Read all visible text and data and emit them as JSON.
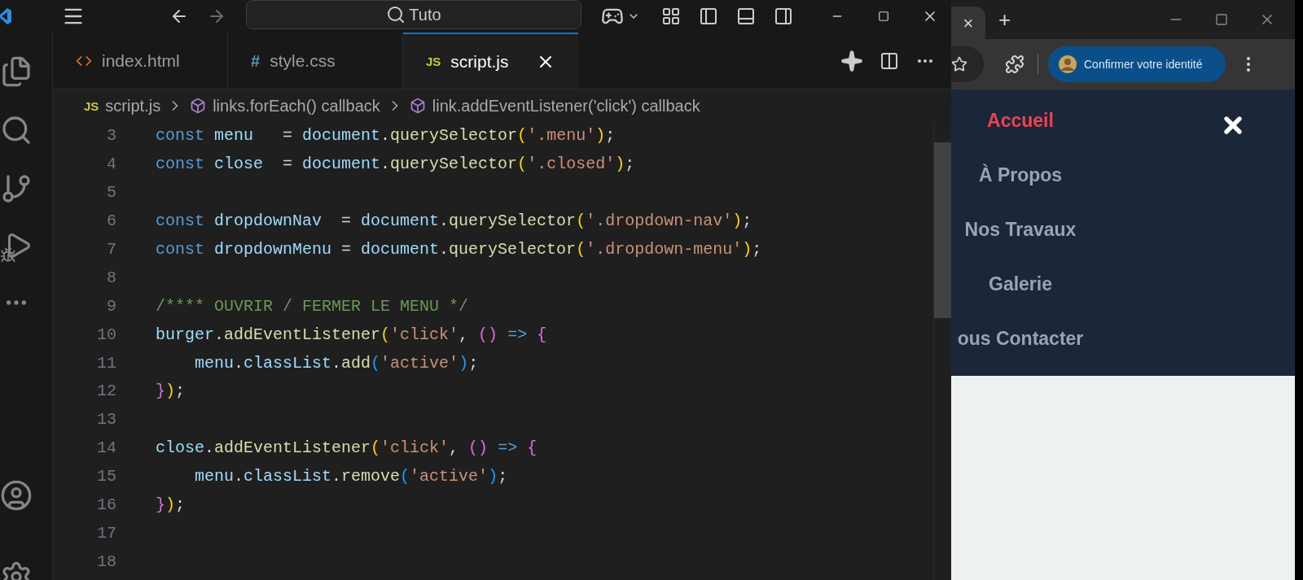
{
  "search": {
    "value": "Tuto"
  },
  "tabs": [
    {
      "label": "index.html",
      "kind": "html",
      "selected": false
    },
    {
      "label": "style.css",
      "kind": "css",
      "badge": "#",
      "selected": false
    },
    {
      "label": "script.js",
      "kind": "js",
      "badge": "JS",
      "selected": true
    }
  ],
  "breadcrumb": [
    {
      "label": "script.js",
      "kind": "js",
      "badge": "JS"
    },
    {
      "label": "links.forEach() callback",
      "kind": "symbol"
    },
    {
      "label": "link.addEventListener('click') callback",
      "kind": "symbol"
    }
  ],
  "code_lines": [
    {
      "number": "3",
      "tokens": [
        {
          "text": "const",
          "kind": "keyword"
        },
        {
          "text": " menu",
          "kind": "variable"
        },
        {
          "text": "   = ",
          "kind": "plain"
        },
        {
          "text": "document",
          "kind": "variable"
        },
        {
          "text": ".",
          "kind": "plain"
        },
        {
          "text": "querySelector",
          "kind": "function"
        },
        {
          "text": "(",
          "kind": "bracket1"
        },
        {
          "text": "'.menu'",
          "kind": "string"
        },
        {
          "text": ")",
          "kind": "bracket1"
        },
        {
          "text": ";",
          "kind": "plain"
        }
      ]
    },
    {
      "number": "4",
      "tokens": [
        {
          "text": "const",
          "kind": "keyword"
        },
        {
          "text": " close",
          "kind": "variable"
        },
        {
          "text": "  = ",
          "kind": "plain"
        },
        {
          "text": "document",
          "kind": "variable"
        },
        {
          "text": ".",
          "kind": "plain"
        },
        {
          "text": "querySelector",
          "kind": "function"
        },
        {
          "text": "(",
          "kind": "bracket1"
        },
        {
          "text": "'.closed'",
          "kind": "string"
        },
        {
          "text": ")",
          "kind": "bracket1"
        },
        {
          "text": ";",
          "kind": "plain"
        }
      ]
    },
    {
      "number": "5"
    },
    {
      "number": "6",
      "tokens": [
        {
          "text": "const",
          "kind": "keyword"
        },
        {
          "text": " dropdownNav",
          "kind": "variable"
        },
        {
          "text": "  = ",
          "kind": "plain"
        },
        {
          "text": "document",
          "kind": "variable"
        },
        {
          "text": ".",
          "kind": "plain"
        },
        {
          "text": "querySelector",
          "kind": "function"
        },
        {
          "text": "(",
          "kind": "bracket1"
        },
        {
          "text": "'.dropdown-nav'",
          "kind": "string"
        },
        {
          "text": ")",
          "kind": "bracket1"
        },
        {
          "text": ";",
          "kind": "plain"
        }
      ]
    },
    {
      "number": "7",
      "tokens": [
        {
          "text": "const",
          "kind": "keyword"
        },
        {
          "text": " dropdownMenu",
          "kind": "variable"
        },
        {
          "text": " = ",
          "kind": "plain"
        },
        {
          "text": "document",
          "kind": "variable"
        },
        {
          "text": ".",
          "kind": "plain"
        },
        {
          "text": "querySelector",
          "kind": "function"
        },
        {
          "text": "(",
          "kind": "bracket1"
        },
        {
          "text": "'.dropdown-menu'",
          "kind": "string"
        },
        {
          "text": ")",
          "kind": "bracket1"
        },
        {
          "text": ";",
          "kind": "plain"
        }
      ]
    },
    {
      "number": "8"
    },
    {
      "number": "9",
      "tokens": [
        {
          "text": "/**** OUVRIR / FERMER LE MENU */",
          "kind": "comment"
        }
      ]
    },
    {
      "number": "10",
      "tokens": [
        {
          "text": "burger",
          "kind": "variable"
        },
        {
          "text": ".",
          "kind": "plain"
        },
        {
          "text": "addEventListener",
          "kind": "function"
        },
        {
          "text": "(",
          "kind": "bracket1"
        },
        {
          "text": "'click'",
          "kind": "string"
        },
        {
          "text": ", ",
          "kind": "plain"
        },
        {
          "text": "()",
          "kind": "bracket2"
        },
        {
          "text": " =>",
          "kind": "keyword"
        },
        {
          "text": " {",
          "kind": "bracket2"
        }
      ]
    },
    {
      "number": "11",
      "tokens": [
        {
          "text": "    menu",
          "kind": "variable"
        },
        {
          "text": ".",
          "kind": "plain"
        },
        {
          "text": "classList",
          "kind": "variable"
        },
        {
          "text": ".",
          "kind": "plain"
        },
        {
          "text": "add",
          "kind": "function"
        },
        {
          "text": "(",
          "kind": "bracket3"
        },
        {
          "text": "'active'",
          "kind": "string"
        },
        {
          "text": ")",
          "kind": "bracket3"
        },
        {
          "text": ";",
          "kind": "plain"
        }
      ]
    },
    {
      "number": "12",
      "tokens": [
        {
          "text": "}",
          "kind": "bracket2"
        },
        {
          "text": ")",
          "kind": "bracket1"
        },
        {
          "text": ";",
          "kind": "plain"
        }
      ]
    },
    {
      "number": "13"
    },
    {
      "number": "14",
      "tokens": [
        {
          "text": "close",
          "kind": "variable"
        },
        {
          "text": ".",
          "kind": "plain"
        },
        {
          "text": "addEventListener",
          "kind": "function"
        },
        {
          "text": "(",
          "kind": "bracket1"
        },
        {
          "text": "'click'",
          "kind": "string"
        },
        {
          "text": ", ",
          "kind": "plain"
        },
        {
          "text": "()",
          "kind": "bracket2"
        },
        {
          "text": " =>",
          "kind": "keyword"
        },
        {
          "text": " {",
          "kind": "bracket2"
        }
      ]
    },
    {
      "number": "15",
      "tokens": [
        {
          "text": "    menu",
          "kind": "variable"
        },
        {
          "text": ".",
          "kind": "plain"
        },
        {
          "text": "classList",
          "kind": "variable"
        },
        {
          "text": ".",
          "kind": "plain"
        },
        {
          "text": "remove",
          "kind": "function"
        },
        {
          "text": "(",
          "kind": "bracket3"
        },
        {
          "text": "'active'",
          "kind": "string"
        },
        {
          "text": ")",
          "kind": "bracket3"
        },
        {
          "text": ";",
          "kind": "plain"
        }
      ]
    },
    {
      "number": "16",
      "tokens": [
        {
          "text": "}",
          "kind": "bracket2"
        },
        {
          "text": ")",
          "kind": "bracket1"
        },
        {
          "text": ";",
          "kind": "plain"
        }
      ]
    },
    {
      "number": "17"
    },
    {
      "number": "18"
    }
  ],
  "browser": {
    "tab_close": "×",
    "new_tab": "+",
    "profile_button": "Confirmer votre identité",
    "nav_items": [
      {
        "label": "Accueil",
        "selected": true
      },
      {
        "label": "À Propos",
        "selected": false
      },
      {
        "label": "Nos Travaux",
        "selected": false
      },
      {
        "label": "Galerie",
        "selected": false
      },
      {
        "label": "ous Contacter",
        "selected": false
      }
    ]
  }
}
